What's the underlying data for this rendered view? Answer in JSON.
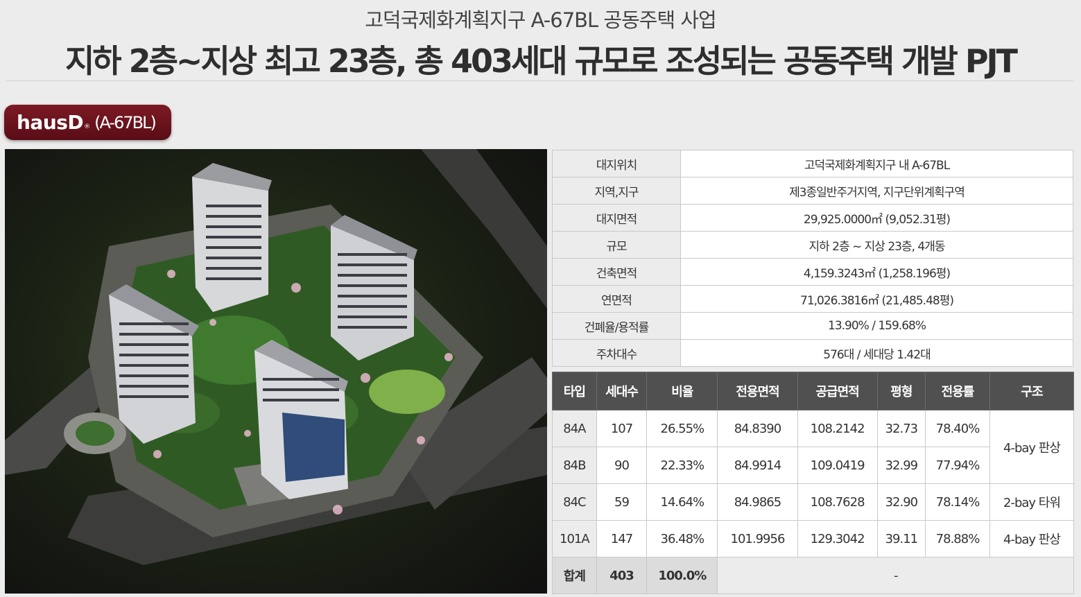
{
  "header": {
    "subtitle": "고덕국제화계획지구 A-67BL 공동주택 사업",
    "title": "지하 2층~지상 최고 23층, 총 403세대 규모로 조성되는 공동주택 개발 PJT"
  },
  "badge": {
    "brand": "hausD",
    "registered_mark": "®",
    "code": "(A-67BL)"
  },
  "colors": {
    "badge": "#6b121c",
    "table_header": "#505050",
    "key_cell": "#ececec",
    "total_row": "#dcdcdc"
  },
  "info_table": [
    {
      "label": "대지위치",
      "value": "고덕국제화계획지구 내 A-67BL"
    },
    {
      "label": "지역,지구",
      "value": "제3종일반주거지역, 지구단위계획구역"
    },
    {
      "label": "대지면적",
      "value": "29,925.0000㎡ (9,052.31평)"
    },
    {
      "label": "규모",
      "value": "지하 2층 ~ 지상 23층, 4개동"
    },
    {
      "label": "건축면적",
      "value": "4,159.3243㎡ (1,258.196평)"
    },
    {
      "label": "연면적",
      "value": "71,026.3816㎡ (21,485.48평)"
    },
    {
      "label": "건폐율/용적률",
      "value": "13.90% / 159.68%"
    },
    {
      "label": "주차대수",
      "value": "576대 / 세대당 1.42대"
    }
  ],
  "unit_table": {
    "headers": [
      "타입",
      "세대수",
      "비율",
      "전용면적",
      "공급면적",
      "평형",
      "전용률",
      "구조"
    ],
    "rows": [
      {
        "type": "84A",
        "units": "107",
        "ratio": "26.55%",
        "exclusive": "84.8390",
        "supply": "108.2142",
        "pyeong": "32.73",
        "rate": "78.40%"
      },
      {
        "type": "84B",
        "units": "90",
        "ratio": "22.33%",
        "exclusive": "84.9914",
        "supply": "109.0419",
        "pyeong": "32.99",
        "rate": "77.94%"
      },
      {
        "type": "84C",
        "units": "59",
        "ratio": "14.64%",
        "exclusive": "84.9865",
        "supply": "108.7628",
        "pyeong": "32.90",
        "rate": "78.14%"
      },
      {
        "type": "101A",
        "units": "147",
        "ratio": "36.48%",
        "exclusive": "101.9956",
        "supply": "129.3042",
        "pyeong": "39.11",
        "rate": "78.88%"
      }
    ],
    "structures": [
      "4-bay 판상",
      "2-bay 타워",
      "4-bay 판상"
    ],
    "total": {
      "label": "합계",
      "units": "403",
      "ratio": "100.0%",
      "rest": "-"
    }
  }
}
